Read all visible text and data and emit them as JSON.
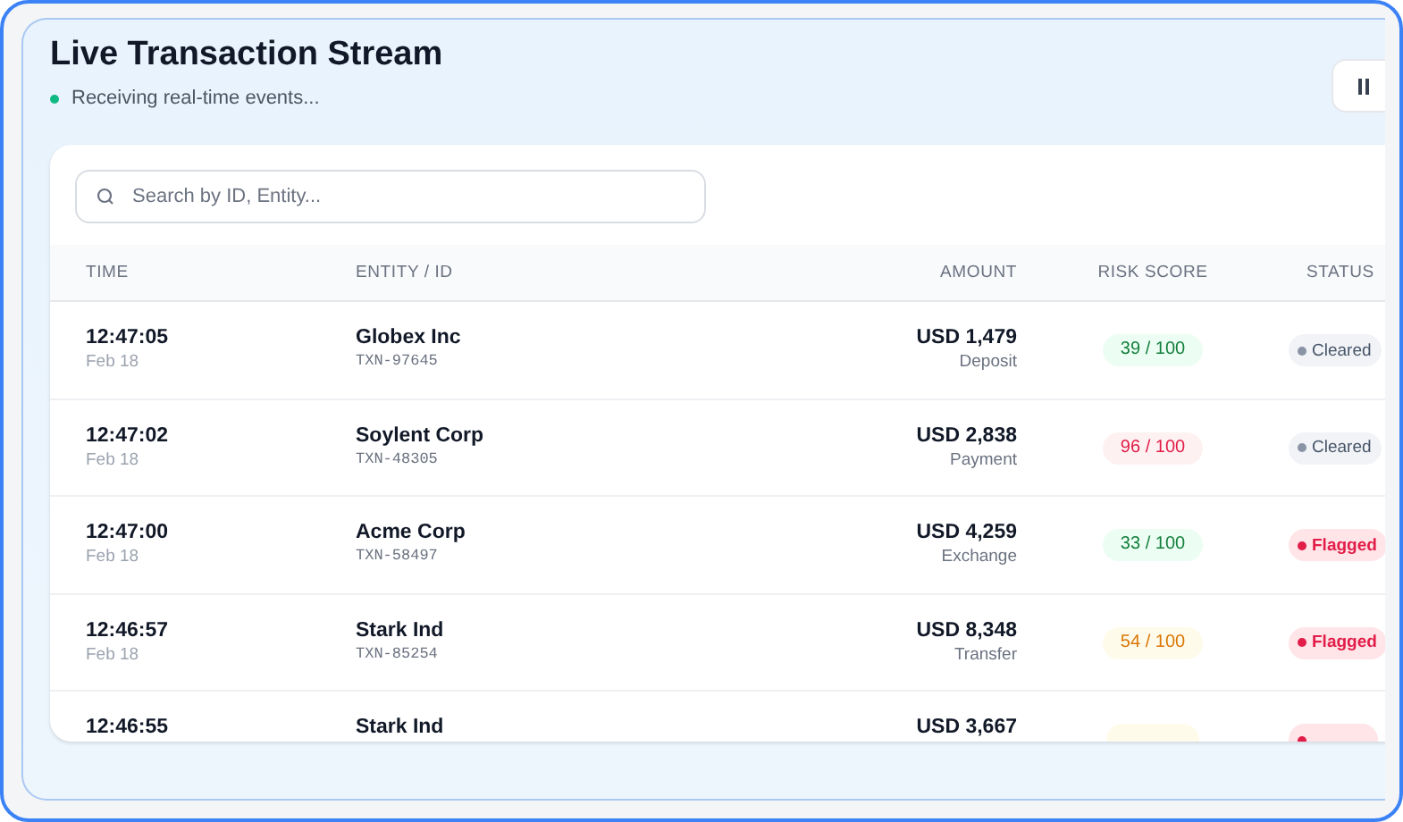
{
  "header": {
    "title": "Live Transaction Stream",
    "status_text": "Receiving real-time events...",
    "live": true
  },
  "search": {
    "placeholder": "Search by ID, Entity..."
  },
  "table": {
    "columns": [
      "TIME",
      "ENTITY / ID",
      "AMOUNT",
      "RISK SCORE",
      "STATUS"
    ],
    "rows": [
      {
        "time": "12:47:05",
        "date": "Feb 18",
        "entity": "Globex Inc",
        "id": "TXN-97645",
        "amount": "USD 1,479",
        "type": "Deposit",
        "risk": {
          "text": "39 / 100",
          "kind": "low"
        },
        "status": {
          "text": "Cleared",
          "kind": "cleared"
        }
      },
      {
        "time": "12:47:02",
        "date": "Feb 18",
        "entity": "Soylent Corp",
        "id": "TXN-48305",
        "amount": "USD 2,838",
        "type": "Payment",
        "risk": {
          "text": "96 / 100",
          "kind": "high"
        },
        "status": {
          "text": "Cleared",
          "kind": "cleared"
        }
      },
      {
        "time": "12:47:00",
        "date": "Feb 18",
        "entity": "Acme Corp",
        "id": "TXN-58497",
        "amount": "USD 4,259",
        "type": "Exchange",
        "risk": {
          "text": "33 / 100",
          "kind": "low"
        },
        "status": {
          "text": "Flagged",
          "kind": "flagged"
        }
      },
      {
        "time": "12:46:57",
        "date": "Feb 18",
        "entity": "Stark Ind",
        "id": "TXN-85254",
        "amount": "USD 8,348",
        "type": "Transfer",
        "risk": {
          "text": "54 / 100",
          "kind": "medium"
        },
        "status": {
          "text": "Flagged",
          "kind": "flagged"
        }
      },
      {
        "time": "12:46:55",
        "entity": "Stark Ind",
        "amount": "USD 3,667",
        "risk": {
          "kind": "medium"
        },
        "status": {
          "kind": "flagged"
        }
      }
    ]
  }
}
